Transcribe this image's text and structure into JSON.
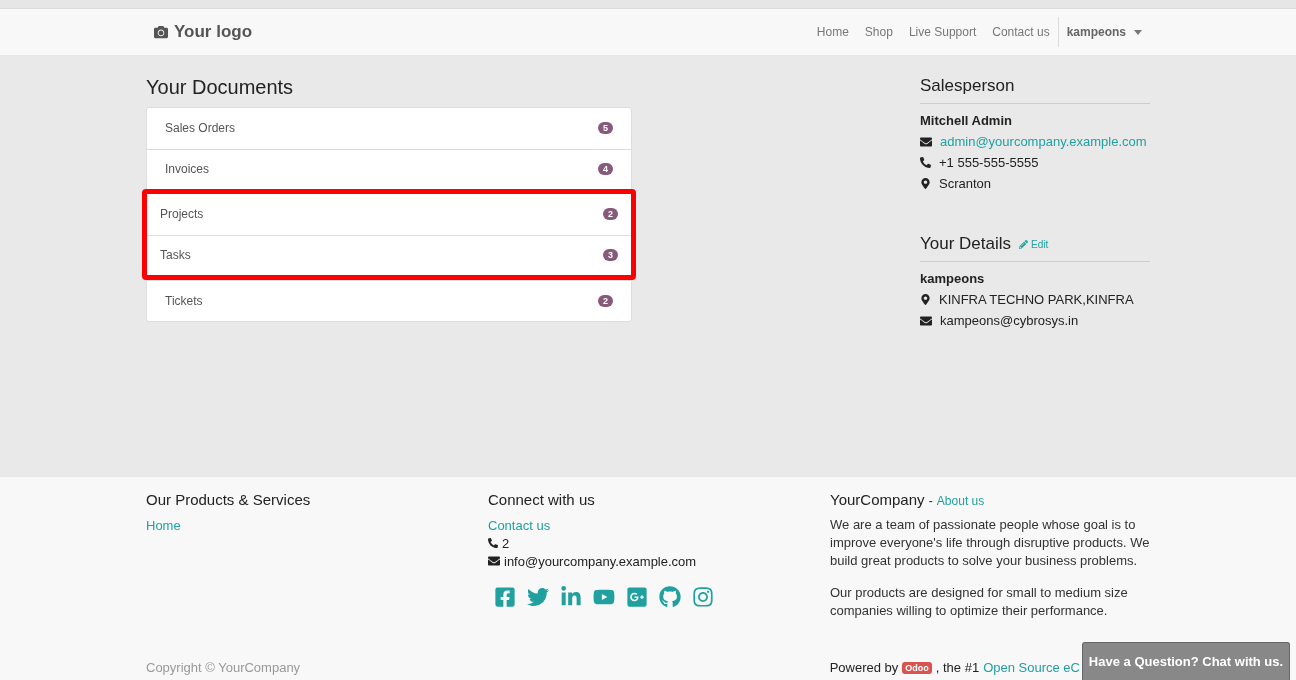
{
  "header": {
    "logo": "Your logo",
    "nav": [
      {
        "label": "Home"
      },
      {
        "label": "Shop"
      },
      {
        "label": "Live Support"
      },
      {
        "label": "Contact us"
      }
    ],
    "user": "kampeons"
  },
  "documents": {
    "title": "Your Documents",
    "items": [
      {
        "label": "Sales Orders",
        "count": "5",
        "highlighted": false
      },
      {
        "label": "Invoices",
        "count": "4",
        "highlighted": false
      },
      {
        "label": "Projects",
        "count": "2",
        "highlighted": true
      },
      {
        "label": "Tasks",
        "count": "3",
        "highlighted": true
      },
      {
        "label": "Tickets",
        "count": "2",
        "highlighted": false
      }
    ]
  },
  "salesperson": {
    "title": "Salesperson",
    "name": "Mitchell Admin",
    "lines": [
      {
        "kind": "email",
        "text": "admin@yourcompany.example.com"
      },
      {
        "kind": "phone",
        "text": "+1 555-555-5555"
      },
      {
        "kind": "address",
        "text": "Scranton"
      }
    ]
  },
  "details": {
    "title": "Your Details",
    "edit": "Edit",
    "name": "kampeons",
    "lines": [
      {
        "kind": "address",
        "text": "KINFRA TECHNO PARK,KINFRA"
      },
      {
        "kind": "email",
        "text": "kampeons@cybrosys.in"
      }
    ]
  },
  "footer": {
    "products": {
      "title": "Our Products & Services",
      "links": [
        "Home"
      ]
    },
    "connect": {
      "title": "Connect with us",
      "link": "Contact us",
      "phone": "2",
      "email": "info@yourcompany.example.com"
    },
    "company": {
      "name": "YourCompany",
      "separator": "-",
      "link": "About us",
      "paragraphs": [
        "We are a team of passionate people whose goal is to improve everyone's life through disruptive products. We build great products to solve your business problems.",
        "Our products are designed for small to medium size companies willing to optimize their performance."
      ]
    },
    "copyright": "Copyright © YourCompany",
    "powered": {
      "before": "Powered by",
      "brand": "Odoo",
      "middle": ", the #1",
      "link": "Open Source eC"
    }
  },
  "chat_button": "Have a Question? Chat with us."
}
